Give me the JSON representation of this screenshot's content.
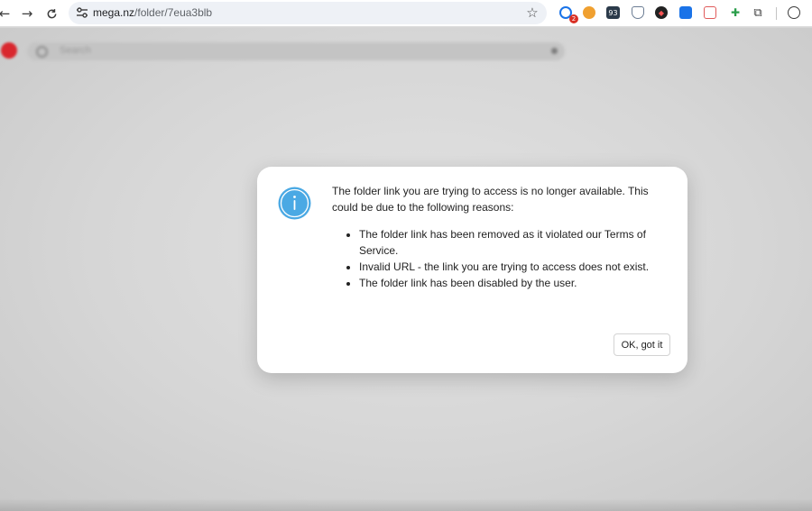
{
  "browser": {
    "url_host": "mega.nz",
    "url_path": "/folder/7eua3blb",
    "extension_badge": "2",
    "extension_label": "93",
    "colors": {
      "toolbar": "#ffffff",
      "omnibox": "#eef1f6"
    }
  },
  "page": {
    "search_placeholder": "Search",
    "brand_color": "#d9272e"
  },
  "dialog": {
    "icon": "info-icon",
    "icon_color": "#4aa9e4",
    "message": "The folder link you are trying to access is no longer available. This could be due to the following reasons:",
    "reasons": [
      "The folder link has been removed as it violated our Terms of Service.",
      "Invalid URL - the link you are trying to access does not exist.",
      "The folder link has been disabled by the user."
    ],
    "ok_label": "OK, got it"
  }
}
